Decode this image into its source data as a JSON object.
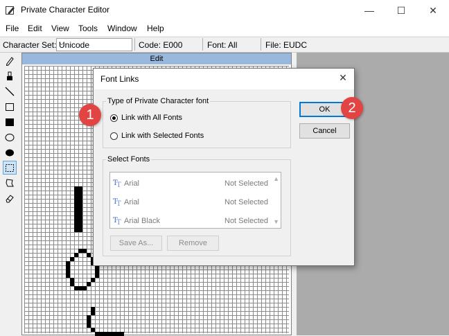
{
  "window": {
    "title": "Private Character Editor",
    "controls": {
      "minimize": "—",
      "maximize": "☐",
      "close": "✕"
    }
  },
  "menu": [
    "File",
    "Edit",
    "View",
    "Tools",
    "Window",
    "Help"
  ],
  "toolbar": {
    "charset_label": "Character Set:",
    "charset_value": "Unicode",
    "code": "Code: E000",
    "font": "Font: All",
    "file": "File: EUDC"
  },
  "tools": [
    "pencil-icon",
    "brush-icon",
    "line-icon",
    "hollow-rectangle-icon",
    "filled-rectangle-icon",
    "hollow-ellipse-icon",
    "filled-ellipse-icon",
    "rectangular-selection-icon",
    "freeform-selection-icon",
    "eraser-icon"
  ],
  "editor": {
    "caption": "Edit"
  },
  "dialog": {
    "title": "Font Links",
    "close": "✕",
    "type_group_label": "Type of Private Character font",
    "radio_all": "Link with All Fonts",
    "radio_selected": "Link with Selected Fonts",
    "selected_option": "all",
    "ok_label": "OK",
    "cancel_label": "Cancel",
    "select_group_label": "Select Fonts",
    "fonts": [
      {
        "name": "Arial",
        "state": "Not Selected"
      },
      {
        "name": "Arial",
        "state": "Not Selected"
      },
      {
        "name": "Arial Black",
        "state": "Not Selected"
      }
    ],
    "save_as_label": "Save As...",
    "remove_label": "Remove"
  },
  "annotations": {
    "badge1": "1",
    "badge2": "2",
    "color": "#e24444"
  }
}
